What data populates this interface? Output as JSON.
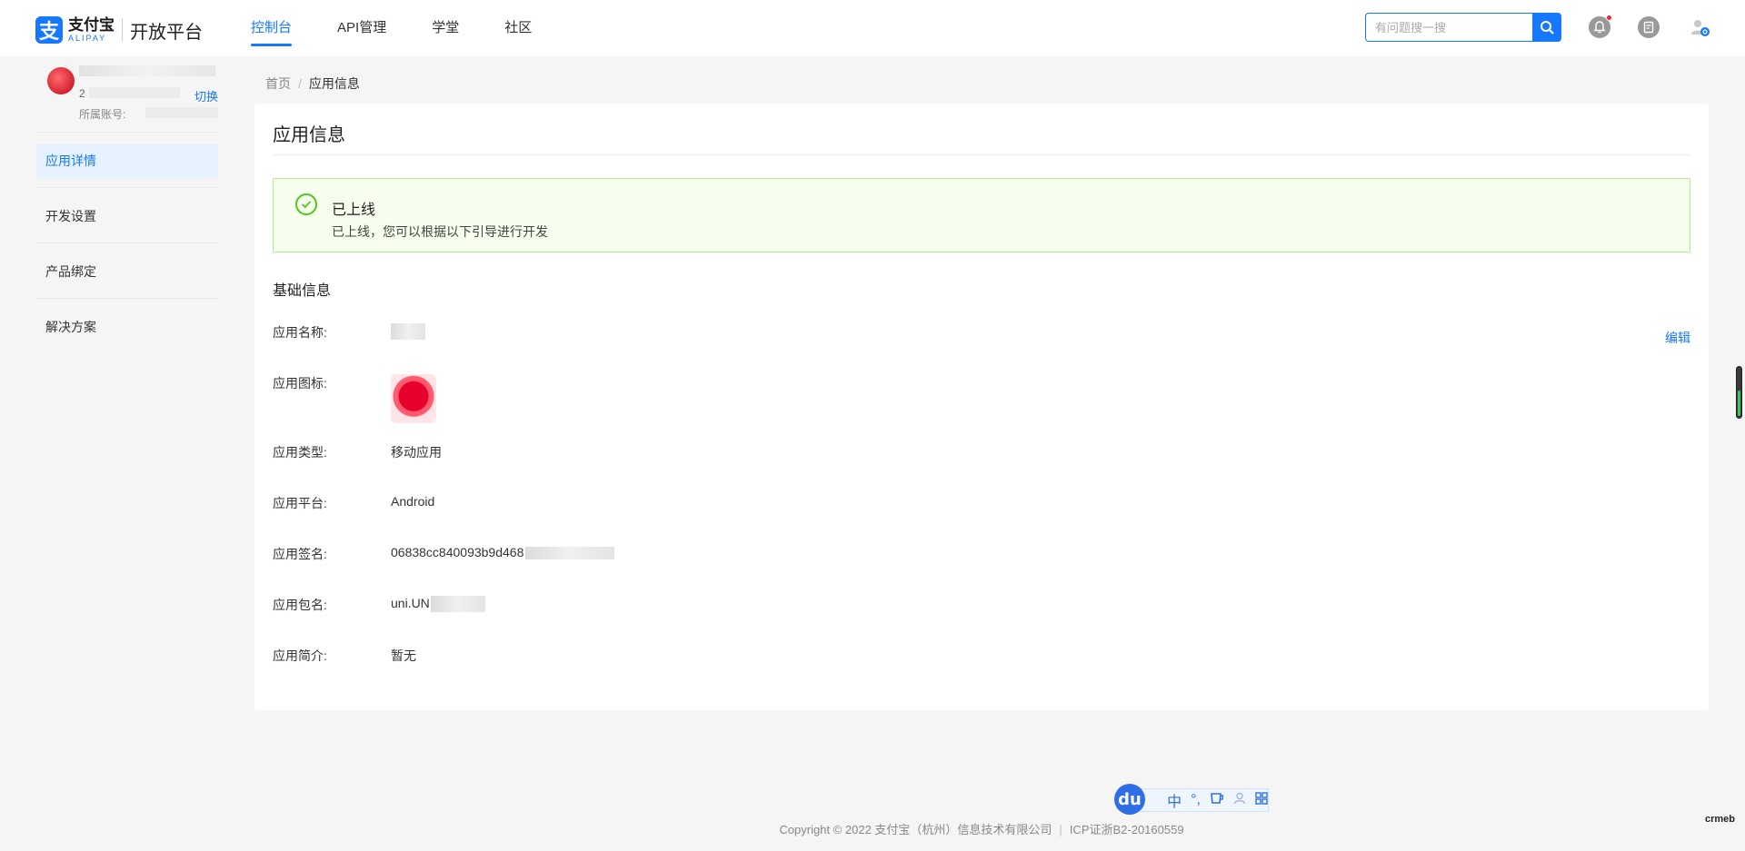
{
  "brand": {
    "logo_glyph": "支",
    "name_cn": "支付宝",
    "name_en": "ALIPAY",
    "platform": "开放平台",
    "accent": "#1677ff"
  },
  "nav": {
    "items": [
      {
        "label": "控制台",
        "active": true
      },
      {
        "label": "API管理",
        "active": false
      },
      {
        "label": "学堂",
        "active": false
      },
      {
        "label": "社区",
        "active": false
      }
    ]
  },
  "search": {
    "placeholder": "有问题搜一搜",
    "value": ""
  },
  "header_icons": [
    "bell-icon",
    "document-icon",
    "user-settings-icon"
  ],
  "account": {
    "id_prefix": "2",
    "sub_account_label": "所属账号:",
    "switch_label": "切换"
  },
  "sidebar": {
    "items": [
      {
        "label": "应用详情",
        "active": true
      },
      {
        "label": "开发设置",
        "active": false
      },
      {
        "label": "产品绑定",
        "active": false
      },
      {
        "label": "解决方案",
        "active": false
      }
    ]
  },
  "breadcrumb": {
    "home": "首页",
    "separator": "/",
    "current": "应用信息"
  },
  "card": {
    "title": "应用信息",
    "alert": {
      "title": "已上线",
      "description": "已上线，您可以根据以下引导进行开发",
      "color": "#52c41a"
    },
    "section_title": "基础信息",
    "edit_label": "编辑",
    "fields": {
      "name": {
        "label": "应用名称:"
      },
      "icon": {
        "label": "应用图标:"
      },
      "type": {
        "label": "应用类型:",
        "value": "移动应用"
      },
      "platform": {
        "label": "应用平台:",
        "value": "Android"
      },
      "signature": {
        "label": "应用签名:",
        "value": "06838cc840093b9d468"
      },
      "package": {
        "label": "应用包名:",
        "value": "uni.UN"
      },
      "intro": {
        "label": "应用简介:",
        "value": "暂无"
      }
    }
  },
  "footer": {
    "copyright": "Copyright © 2022 支付宝（杭州）信息技术有限公司",
    "divider": "|",
    "icp": "ICP证浙B2-20160559"
  },
  "ime": {
    "logo": "du",
    "lang": "中",
    "punct": "°,"
  },
  "corner_mark": "crmeb"
}
